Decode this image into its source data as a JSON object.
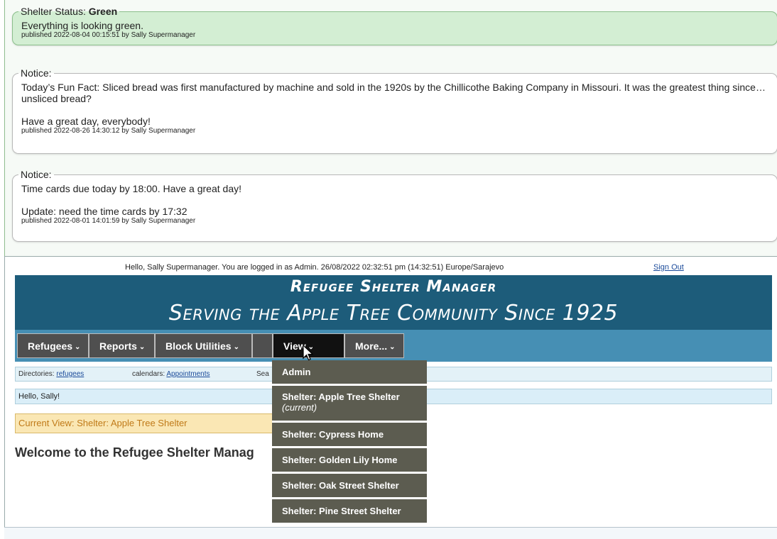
{
  "notices": [
    {
      "legend_label": "Shelter Status:",
      "legend_value": "Green",
      "lines": [
        "Everything is looking green."
      ],
      "published": "published 2022-08-04 00:15:51 by Sally Supermanager"
    },
    {
      "legend_label": "Notice:",
      "lines": [
        "Today’s Fun Fact: Sliced bread was first manufactured by machine and sold in the 1920s by the Chillicothe Baking Company in Missouri. It was the greatest thing since…unsliced bread?",
        "Have a great day, everybody!"
      ],
      "published": "published 2022-08-26 14:30:12 by Sally Supermanager"
    },
    {
      "legend_label": "Notice:",
      "lines": [
        "Time cards due today by 18:00. Have a great day!",
        "Update: need the time cards by 17:32"
      ],
      "published": "published 2022-08-01 14:01:59 by Sally Supermanager"
    }
  ],
  "login": {
    "hello_text": "Hello, Sally Supermanager. You are logged in as Admin. 26/08/2022 02:32:51 pm (14:32:51) Europe/Sarajevo",
    "sign_out": "Sign Out"
  },
  "banner": {
    "title": "Refugee Shelter Manager",
    "subtitle": "Serving the Apple Tree Community Since 1925"
  },
  "menu": {
    "items": [
      "Refugees",
      "Reports",
      "Block Utilities",
      "View",
      "More..."
    ],
    "chevron": "⌄"
  },
  "directories": {
    "label": "Directories:",
    "link": "refugees",
    "calendars_label": "calendars:",
    "calendars_link": "Appointments",
    "search_label": "Sea"
  },
  "hello_bar": "Hello, Sally!",
  "current_view": "Current View: Shelter: Apple Tree Shelter",
  "welcome": "Welcome to the Refugee Shelter Manag",
  "dropdown": {
    "items": [
      {
        "label": "Admin"
      },
      {
        "label": "Shelter: Apple Tree Shelter",
        "note": "(current)"
      },
      {
        "label": "Shelter: Cypress Home"
      },
      {
        "label": "Shelter: Golden Lily Home"
      },
      {
        "label": "Shelter: Oak Street Shelter"
      },
      {
        "label": "Shelter: Pine Street Shelter"
      }
    ]
  }
}
